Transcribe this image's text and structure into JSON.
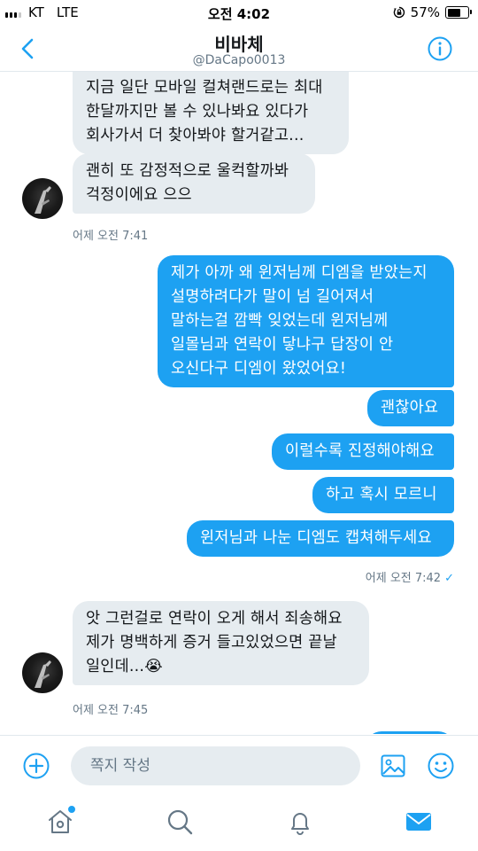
{
  "status_bar": {
    "carrier": "KT",
    "network": "LTE",
    "time": "오전 4:02",
    "battery": "57%",
    "battery_level": 0.57
  },
  "header": {
    "title": "비바체",
    "handle": "@DaCapo0013"
  },
  "messages": [
    {
      "direction": "in",
      "text": "지금 일단 모바일 컬쳐랜드로는 최대\n한달까지만 볼 수 있나봐요 있다가\n회사가서 더 찾아봐야 할거같고..."
    },
    {
      "direction": "in",
      "text": "괜히 또 감정적으로 울컥할까봐\n걱정이에요 으으"
    },
    {
      "direction": "meta",
      "text": "어제 오전 7:41"
    },
    {
      "direction": "out",
      "text": "제가 아까 왜 윈저님께 디엠을 받았는지\n설명하려다가 말이 넘 길어져서\n말하는걸 깜빡 잊었는데 윈저님께\n일몰님과 연락이 닿냐구 답장이 안\n오신다구 디엠이 왔었어요!"
    },
    {
      "direction": "out",
      "text": "괜찮아요"
    },
    {
      "direction": "out",
      "text": "이럴수록 진정해야해요"
    },
    {
      "direction": "out",
      "text": "하고 혹시 모르니"
    },
    {
      "direction": "out",
      "text": "윈저님과 나눈 디엠도 캡쳐해두세요"
    },
    {
      "direction": "meta",
      "text": "어제 오전 7:42",
      "read": "✓"
    },
    {
      "direction": "in",
      "text": "앗 그런걸로 연락이 오게 해서 죄송해요\n제가 명백하게 증거 들고있었으면 끝날\n일인데...😭"
    },
    {
      "direction": "meta",
      "text": "어제 오전 7:45"
    }
  ],
  "composer": {
    "placeholder": "쪽지 작성"
  },
  "colors": {
    "accent": "#1da1f2",
    "incoming_bubble": "#e6ecf0",
    "meta_text": "#657786"
  },
  "icons": {
    "back": "chevron-left-icon",
    "info": "info-icon",
    "add": "plus-circle-icon",
    "image": "image-icon",
    "gif": "smiley-icon",
    "home": "home-icon",
    "search": "search-icon",
    "notifications": "bell-icon",
    "messages": "envelope-icon"
  }
}
